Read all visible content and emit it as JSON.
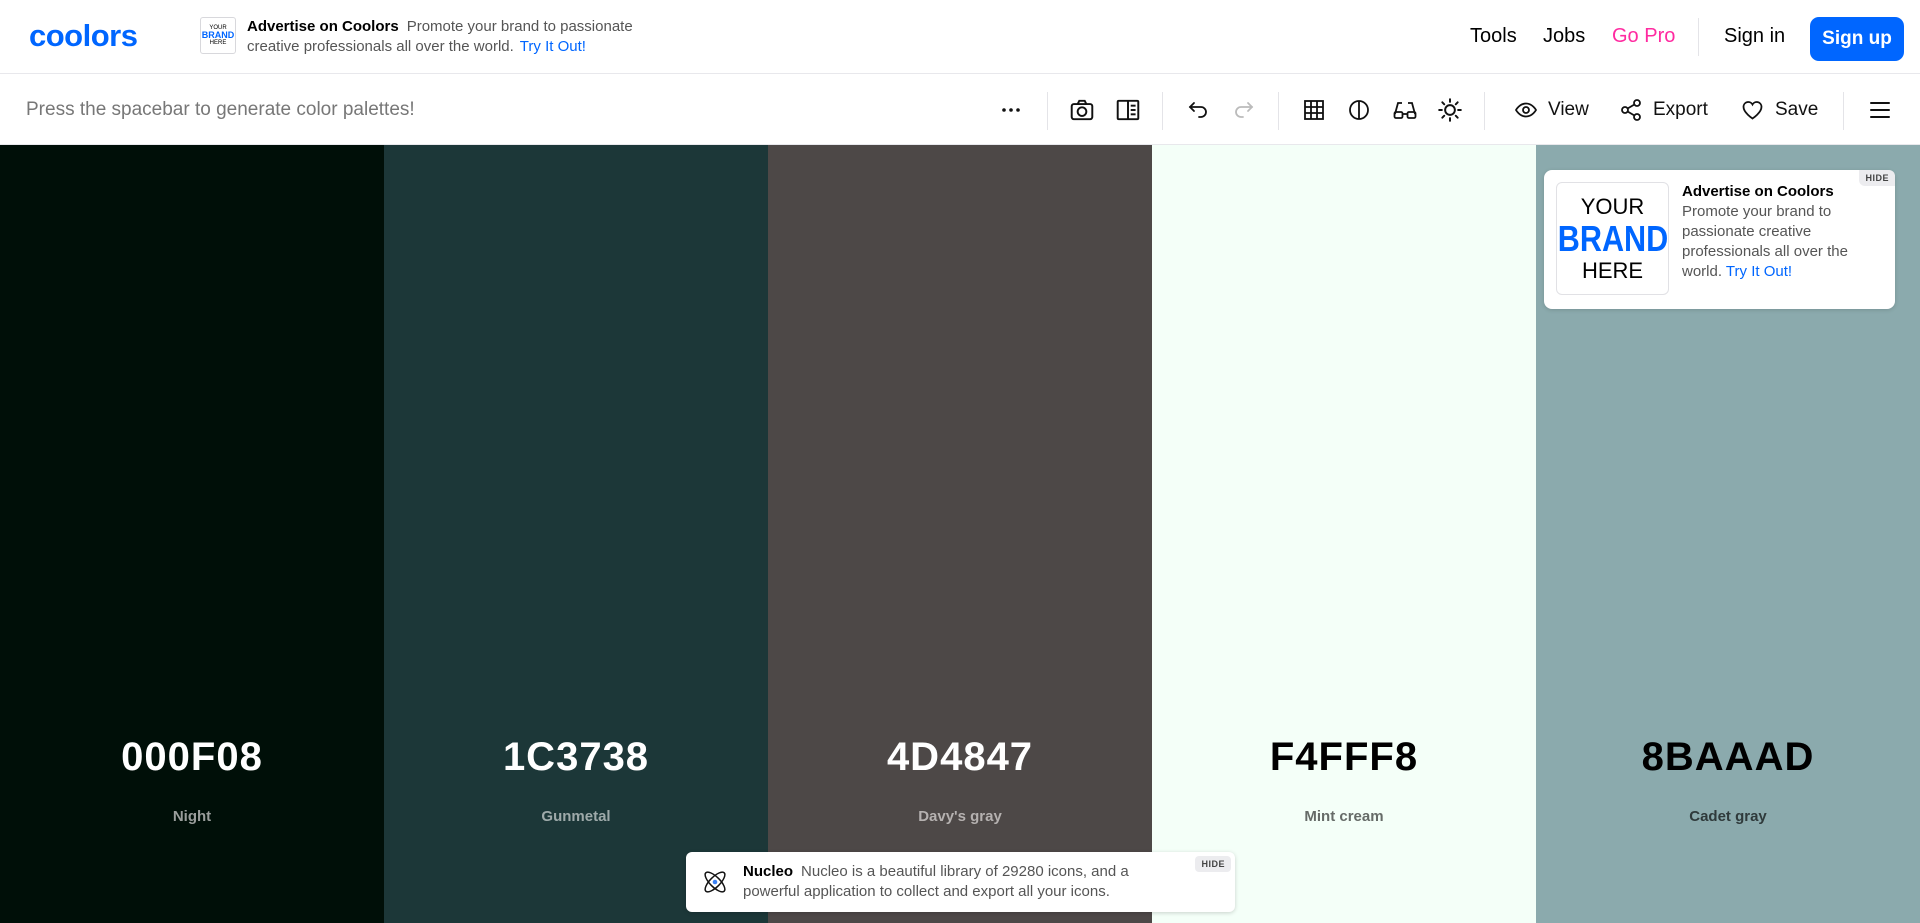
{
  "header": {
    "logo_text": "coolors",
    "ad": {
      "brand_lines": [
        "YOUR",
        "BRAND",
        "HERE"
      ],
      "title": "Advertise on Coolors",
      "body": "Promote your brand to passionate creative professionals all over the world.",
      "cta": "Try It Out!"
    },
    "nav": {
      "tools": "Tools",
      "jobs": "Jobs",
      "go_pro": "Go Pro",
      "sign_in": "Sign in",
      "sign_up": "Sign up"
    }
  },
  "toolbar": {
    "hint": "Press the spacebar to generate color palettes!",
    "icons": [
      "more-icon",
      "camera-icon",
      "side-panel-icon",
      "undo-icon",
      "redo-icon",
      "grid-icon",
      "contrast-icon",
      "glasses-icon",
      "sun-icon"
    ],
    "view_label": "View",
    "export_label": "Export",
    "save_label": "Save"
  },
  "palette": [
    {
      "hex": "000F08",
      "name": "Night",
      "color": "#000F08",
      "text_color": "#FFFFFF",
      "name_color": "#9A9E9C"
    },
    {
      "hex": "1C3738",
      "name": "Gunmetal",
      "color": "#1C3738",
      "text_color": "#FFFFFF",
      "name_color": "#9EAAAA"
    },
    {
      "hex": "4D4847",
      "name": "Davy's gray",
      "color": "#4D4847",
      "text_color": "#FFFFFF",
      "name_color": "#B5B1B0"
    },
    {
      "hex": "F4FFF8",
      "name": "Mint cream",
      "color": "#F4FFF8",
      "text_color": "#000000",
      "name_color": "#666B68"
    },
    {
      "hex": "8BAAAD",
      "name": "Cadet gray",
      "color": "#8BAAAD",
      "text_color": "#000000",
      "name_color": "#2F3A3B"
    }
  ],
  "side_ad": {
    "brand_lines": [
      "YOUR",
      "BRAND",
      "HERE"
    ],
    "title": "Advertise on Coolors",
    "body": "Promote your brand to passionate creative professionals all over the world.",
    "cta": "Try It Out!",
    "hide": "HIDE"
  },
  "bottom_ad": {
    "title": "Nucleo",
    "body": "Nucleo is a beautiful library of 29280 icons, and a powerful application to collect and export all your icons.",
    "hide": "HIDE"
  },
  "colors": {
    "accent": "#0066FF",
    "go_pro": "#FF2AA0"
  }
}
